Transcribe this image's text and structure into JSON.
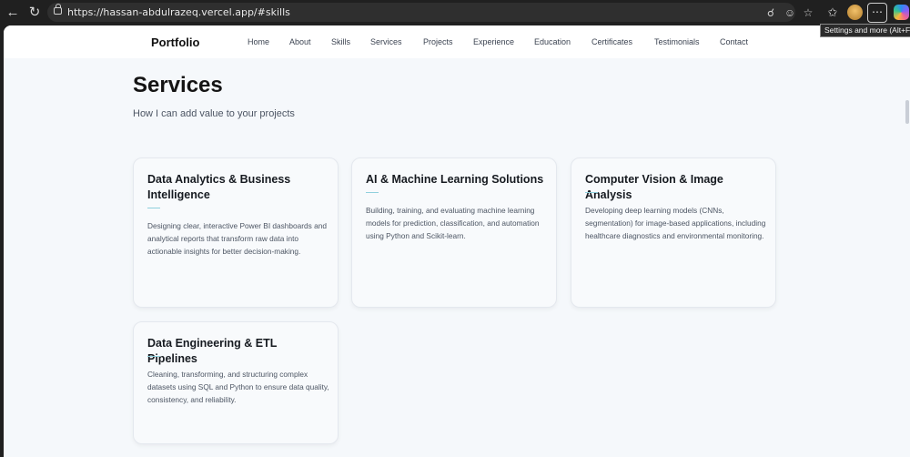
{
  "browser": {
    "url": "https://hassan-abdulrazeq.vercel.app/#skills",
    "tooltip": "Settings and more (Alt+F)",
    "more_label": "⋯"
  },
  "site": {
    "brand": "Portfolio",
    "nav": [
      "Home",
      "About",
      "Skills",
      "Services",
      "Projects",
      "Experience",
      "Education",
      "Certificates",
      "Testimonials",
      "Contact"
    ]
  },
  "section": {
    "title": "Services",
    "subtitle": "How I can add value to your projects"
  },
  "services": [
    {
      "title": "Data Analytics & Business Intelligence",
      "description": "Designing clear, interactive Power BI dashboards and analytical reports that transform raw data into actionable insights for better decision-making."
    },
    {
      "title": "AI & Machine Learning Solutions",
      "description": "Building, training, and evaluating machine learning models for prediction, classification, and automation using Python and Scikit-learn."
    },
    {
      "title": "Computer Vision & Image Analysis",
      "description": "Developing deep learning models (CNNs, segmentation) for image-based applications, including healthcare diagnostics and environmental monitoring."
    },
    {
      "title": "Data Engineering & ETL Pipelines",
      "description": "Cleaning, transforming, and structuring complex datasets using SQL and Python to ensure data quality, consistency, and reliability."
    }
  ],
  "colors": {
    "accent_rule": "#8fd0dd",
    "page_bg": "#f5f8fb",
    "chrome_bg": "#202020"
  },
  "icons": [
    "back-arrow-icon",
    "refresh-icon",
    "lock-icon",
    "zoom-icon",
    "reader-icon",
    "favorite-star-icon",
    "favorites-icon",
    "profile-avatar",
    "more-icon",
    "copilot-icon"
  ]
}
